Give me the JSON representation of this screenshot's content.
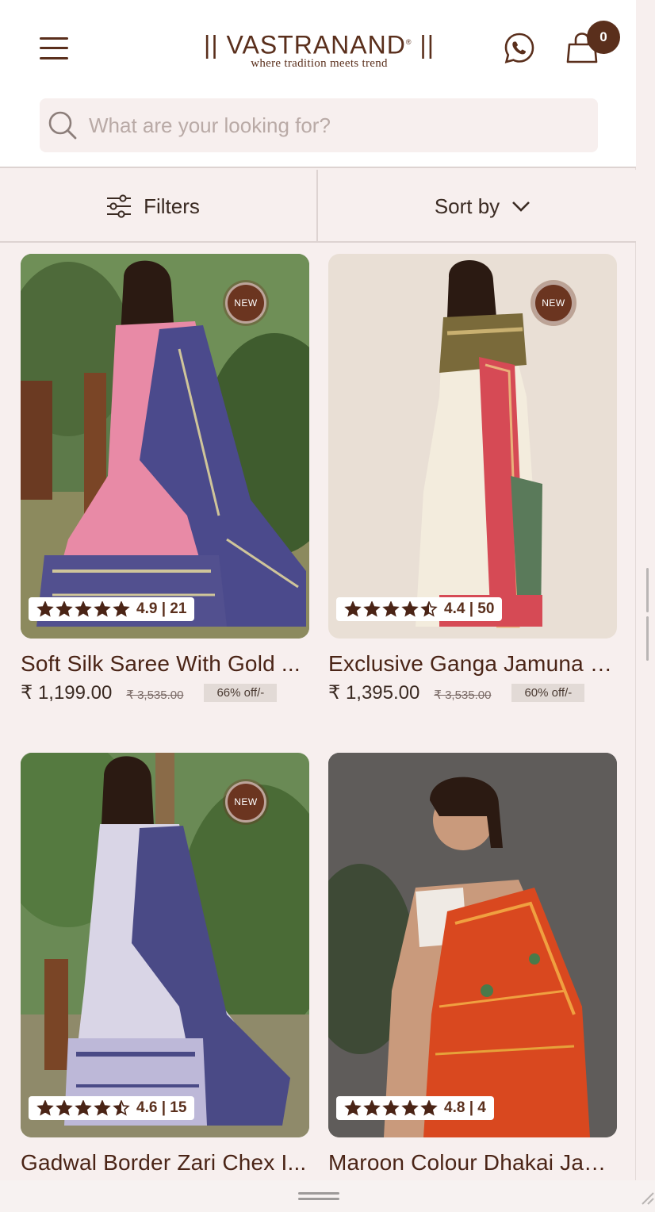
{
  "header": {
    "logo_main": "VASTRANAND",
    "logo_tagline": "where tradition meets trend",
    "cart_count": "0",
    "accent_color": "#5a2f1c"
  },
  "search": {
    "placeholder": "What are your looking for?",
    "value": ""
  },
  "toolbar": {
    "filters_label": "Filters",
    "sort_label": "Sort by"
  },
  "products": [
    {
      "title": "Soft Silk Saree With Gold ...",
      "price": "₹ 1,199.00",
      "mrp": "₹ 3,535.00",
      "discount": "66% off/-",
      "rating": "4.9 | 21",
      "stars": 5,
      "badge": "NEW",
      "theme": "pink-saree"
    },
    {
      "title": "Exclusive Ganga Jamuna Pa...",
      "price": "₹ 1,395.00",
      "mrp": "₹ 3,535.00",
      "discount": "60% off/-",
      "rating": "4.4 | 50",
      "stars": 4.5,
      "badge": "NEW",
      "theme": "white-red-saree"
    },
    {
      "title": "Gadwal Border Zari Chex I...",
      "price": "",
      "mrp": "",
      "discount": "",
      "rating": "4.6 | 15",
      "stars": 4.5,
      "badge": "NEW",
      "theme": "lavender-saree"
    },
    {
      "title": "Maroon Colour Dhakai Jam...",
      "price": "",
      "mrp": "",
      "discount": "",
      "rating": "4.8 | 4",
      "stars": 5,
      "badge": "",
      "theme": "orange-saree"
    }
  ]
}
